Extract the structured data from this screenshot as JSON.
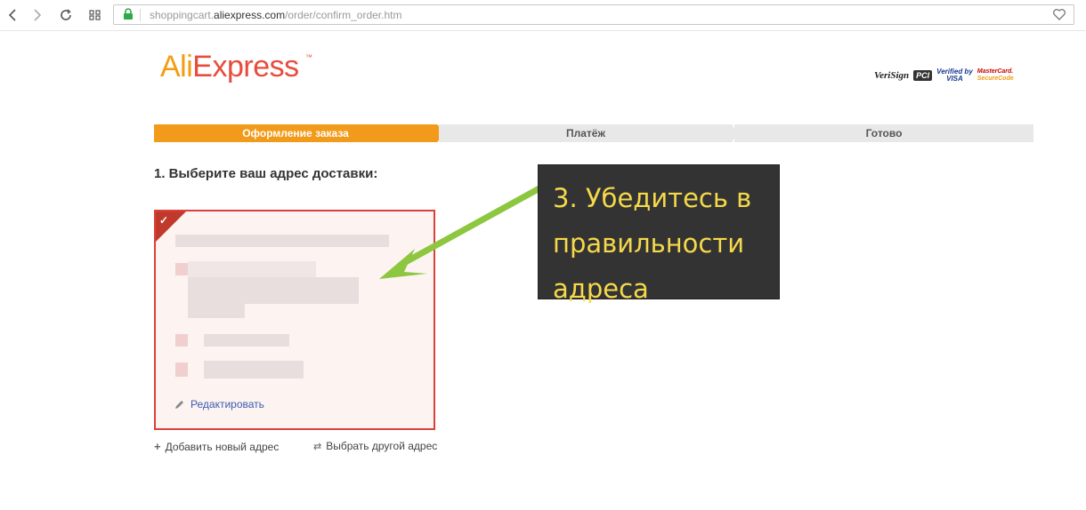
{
  "browser": {
    "url_prefix": "shoppingcart.",
    "url_host": "aliexpress.com",
    "url_path": "/order/confirm_order.htm"
  },
  "logo": {
    "part1": "Ali",
    "part2": "Express",
    "tm": "™"
  },
  "security_badges": {
    "verisign": "VeriSign",
    "pci": "PCI",
    "visa_line1": "Verified by",
    "visa_line2": "VISA",
    "mastercard_line1": "MasterCard.",
    "mastercard_line2": "SecureCode"
  },
  "steps": [
    {
      "label": "Оформление заказа",
      "active": true
    },
    {
      "label": "Платёж",
      "active": false
    },
    {
      "label": "Готово",
      "active": false
    }
  ],
  "section_title": "1. Выберите ваш адрес доставки:",
  "address_card": {
    "selected": true,
    "edit_label": "Редактировать"
  },
  "actions": {
    "add_address": "Добавить новый адрес",
    "choose_other": "Выбрать другой адрес"
  },
  "annotation": {
    "text": "3. Убедитесь в правильности адреса"
  },
  "colors": {
    "accent_orange": "#f29b1b",
    "card_border": "#d9413a",
    "annotation_bg": "#333333",
    "annotation_text": "#f5d94a",
    "arrow_green": "#8dc63f"
  },
  "icons": [
    "back-icon",
    "forward-icon",
    "reload-icon",
    "grid-icon",
    "lock-icon",
    "heart-icon",
    "check-icon",
    "pencil-icon",
    "plus-icon",
    "swap-icon"
  ]
}
